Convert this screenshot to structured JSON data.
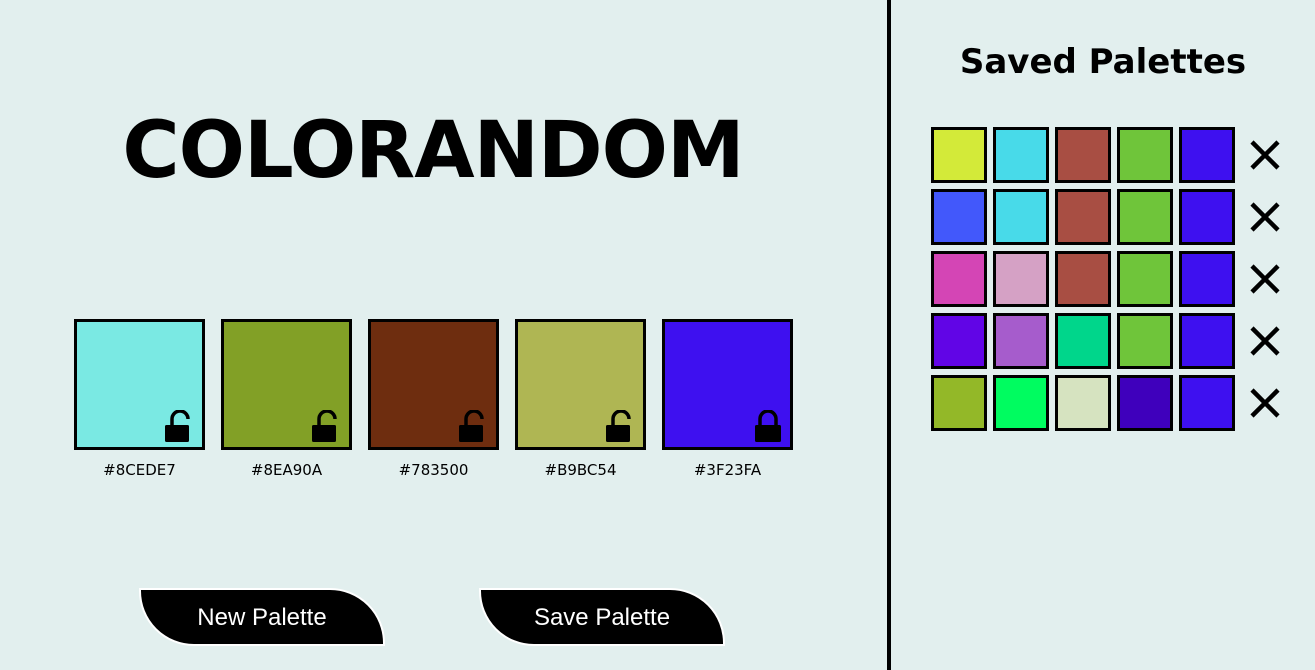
{
  "app": {
    "title": "COLORANDOM"
  },
  "palette": [
    {
      "hex": "#8CEDE7",
      "locked": false
    },
    {
      "hex": "#8EA90A",
      "locked": false
    },
    {
      "hex": "#783500",
      "locked": false
    },
    {
      "hex": "#B9BC54",
      "locked": false
    },
    {
      "hex": "#3F23FA",
      "locked": true
    }
  ],
  "display_colors": [
    "#7ae9e3",
    "#82a026",
    "#6e2d0f",
    "#afb653",
    "#3e10f0"
  ],
  "icons": {
    "unlocked": "unlocked-padlock-icon",
    "locked": "locked-padlock-icon",
    "delete": "close-x-icon"
  },
  "buttons": {
    "new_label": "New Palette",
    "save_label": "Save Palette"
  },
  "sidebar": {
    "title": "Saved Palettes",
    "saved": [
      [
        "#d3ea39",
        "#48dae9",
        "#a84e43",
        "#6fc53a",
        "#3e10f0"
      ],
      [
        "#4258fb",
        "#48dae9",
        "#a84e43",
        "#6fc53a",
        "#3e10f0"
      ],
      [
        "#d445b5",
        "#d5a1c5",
        "#a84e43",
        "#6fc53a",
        "#3e10f0"
      ],
      [
        "#6105e6",
        "#a65ccc",
        "#00d68b",
        "#6fc53a",
        "#3e10f0"
      ],
      [
        "#93b828",
        "#00fc60",
        "#d6e3c0",
        "#3f00bc",
        "#3e10f0"
      ]
    ]
  }
}
